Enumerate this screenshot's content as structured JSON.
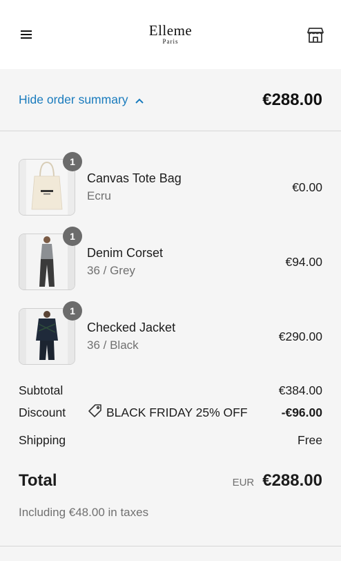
{
  "header": {
    "logo_main": "Elleme",
    "logo_sub": "Paris",
    "menu_icon": "hamburger-menu-icon",
    "store_icon": "storefront-icon"
  },
  "summary_bar": {
    "toggle_label": "Hide order summary",
    "toggle_icon": "chevron-up-icon",
    "total": "€288.00",
    "accent_color": "#197bbd"
  },
  "items": [
    {
      "name": "Canvas Tote Bag",
      "variant": "Ecru",
      "quantity": "1",
      "price": "€0.00"
    },
    {
      "name": "Denim Corset",
      "variant": "36 / Grey",
      "quantity": "1",
      "price": "€94.00"
    },
    {
      "name": "Checked Jacket",
      "variant": "36 / Black",
      "quantity": "1",
      "price": "€290.00"
    }
  ],
  "totals": {
    "subtotal_label": "Subtotal",
    "subtotal_value": "€384.00",
    "discount_label": "Discount",
    "discount_code": "BLACK FRIDAY 25% OFF",
    "discount_icon": "tag-icon",
    "discount_value": "-€96.00",
    "shipping_label": "Shipping",
    "shipping_value": "Free",
    "total_label": "Total",
    "currency": "EUR",
    "total_value": "€288.00",
    "taxes_note": "Including €48.00 in taxes"
  }
}
